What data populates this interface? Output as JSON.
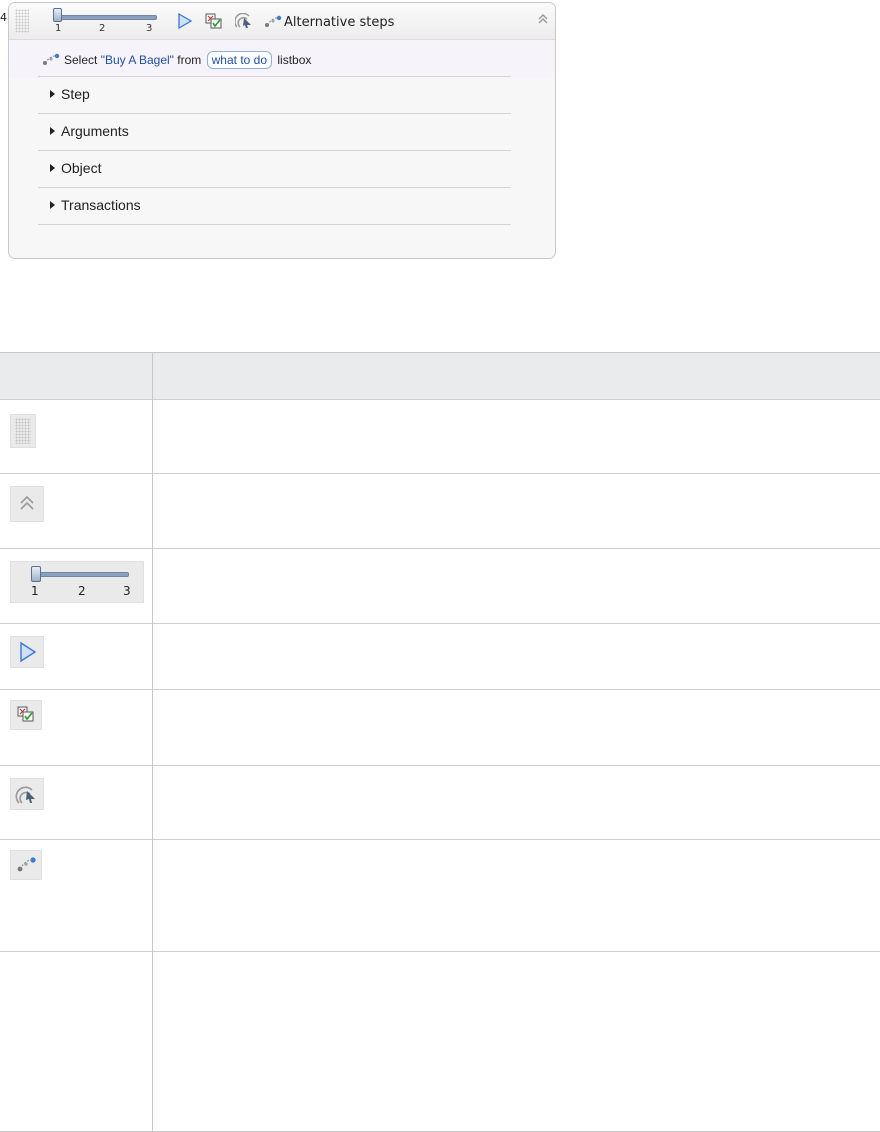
{
  "step_panel": {
    "step_number": "4",
    "slider": {
      "ticks": [
        "1",
        "2",
        "3"
      ],
      "value": 1
    },
    "header_label": "Alternative steps",
    "step_text": {
      "verb": "Select",
      "value": "\"Buy A Bagel\"",
      "from_word": "from",
      "object": "what to do",
      "object_type": "listbox"
    },
    "sections": [
      {
        "label": "Step"
      },
      {
        "label": "Arguments"
      },
      {
        "label": "Object"
      },
      {
        "label": "Transactions"
      }
    ]
  },
  "legend_table": {
    "headers": [
      "",
      ""
    ],
    "rows": [
      {
        "icon": "drag-handle-icon",
        "description": ""
      },
      {
        "icon": "collapse-icon",
        "description": ""
      },
      {
        "icon": "slider-icon",
        "description": "",
        "slider_ticks": [
          "1",
          "2",
          "3"
        ]
      },
      {
        "icon": "play-icon",
        "description": ""
      },
      {
        "icon": "checklist-icon",
        "description": ""
      },
      {
        "icon": "record-icon",
        "description": ""
      },
      {
        "icon": "alternative-steps-icon",
        "description": ""
      },
      {
        "icon": "",
        "description": ""
      }
    ]
  },
  "colors": {
    "accent": "#4a86d8",
    "link_text": "#1d4fa3",
    "header_bg": "#e9ebec",
    "step_row_bg": "#f7f3fa"
  }
}
